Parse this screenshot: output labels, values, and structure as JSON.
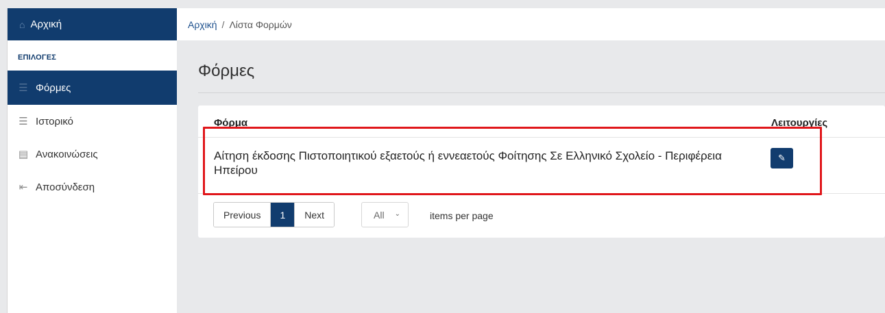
{
  "sidebar": {
    "home_label": "Αρχική",
    "section_label": "ΕΠΙΛΟΓΕΣ",
    "items": [
      {
        "label": "Φόρμες",
        "icon": "list-icon",
        "active": true
      },
      {
        "label": "Ιστορικό",
        "icon": "list-icon",
        "active": false
      },
      {
        "label": "Ανακοινώσεις",
        "icon": "newspaper-icon",
        "active": false
      },
      {
        "label": "Αποσύνδεση",
        "icon": "logout-icon",
        "active": false
      }
    ]
  },
  "breadcrumb": {
    "home": "Αρχική",
    "separator": "/",
    "current": "Λίστα Φορμών"
  },
  "page": {
    "title": "Φόρμες"
  },
  "table": {
    "columns": [
      "Φόρμα",
      "Λειτουργίες"
    ],
    "rows": [
      {
        "form": "Αίτηση έκδοσης Πιστοποιητικού εξαετούς ή εννεαετούς Φοίτησης Σε Ελληνικό Σχολείο - Περιφέρεια Ηπείρου",
        "action_icon": "pencil-icon"
      }
    ]
  },
  "pagination": {
    "previous": "Previous",
    "current_page": "1",
    "next": "Next",
    "per_page_value": "All",
    "per_page_label": "items per page"
  },
  "colors": {
    "primary": "#113c6e",
    "highlight": "#e0161a",
    "background": "#e8e9eb"
  }
}
